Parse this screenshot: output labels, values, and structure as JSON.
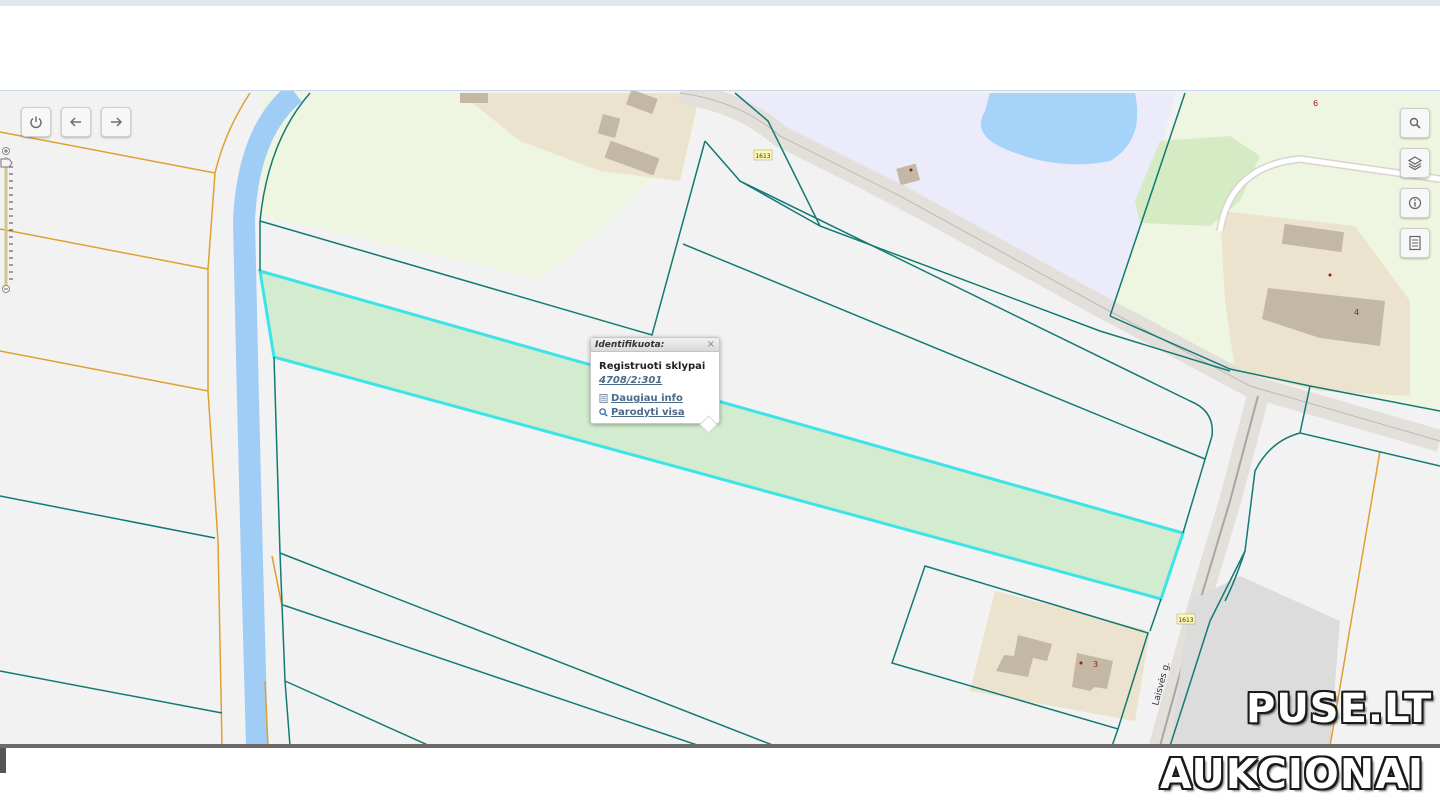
{
  "map": {
    "road_labels": [
      "1613",
      "1613",
      "Laisvės g."
    ],
    "house_numbers": [
      "6",
      "4",
      "3"
    ],
    "colors": {
      "background": "#f2f2f2",
      "parcel_line": "#137a73",
      "cadastral_line": "#e0a030",
      "canal": "#9fcdf5",
      "pond": "#a5d3fa",
      "field": "#eef6e1",
      "yard": "#ece3ce",
      "building": "#c2b8a4",
      "road": "#e3e0db",
      "selected_fill": "#d3eccf",
      "selected_outline": "#3ee3e8",
      "lavender_zone": "#ebebfa",
      "green_area": "#d4ebc3"
    }
  },
  "toolbar": {
    "power_icon": "power-icon",
    "back_icon": "arrow-left-icon",
    "forward_icon": "arrow-right-icon"
  },
  "right_tools": {
    "search_icon": "search-icon",
    "layers_icon": "layers-icon",
    "info_icon": "info-icon",
    "legend_icon": "legend-icon"
  },
  "popup": {
    "header": "Identifikuota:",
    "close": "×",
    "title": "Registruoti sklypai",
    "parcel_id": "4708/2:301",
    "more_info": "Daugiau info",
    "show_all": "Parodyti visa"
  },
  "watermark": {
    "line1": "PUSE.LT",
    "line2": "AUKCIONAI"
  }
}
